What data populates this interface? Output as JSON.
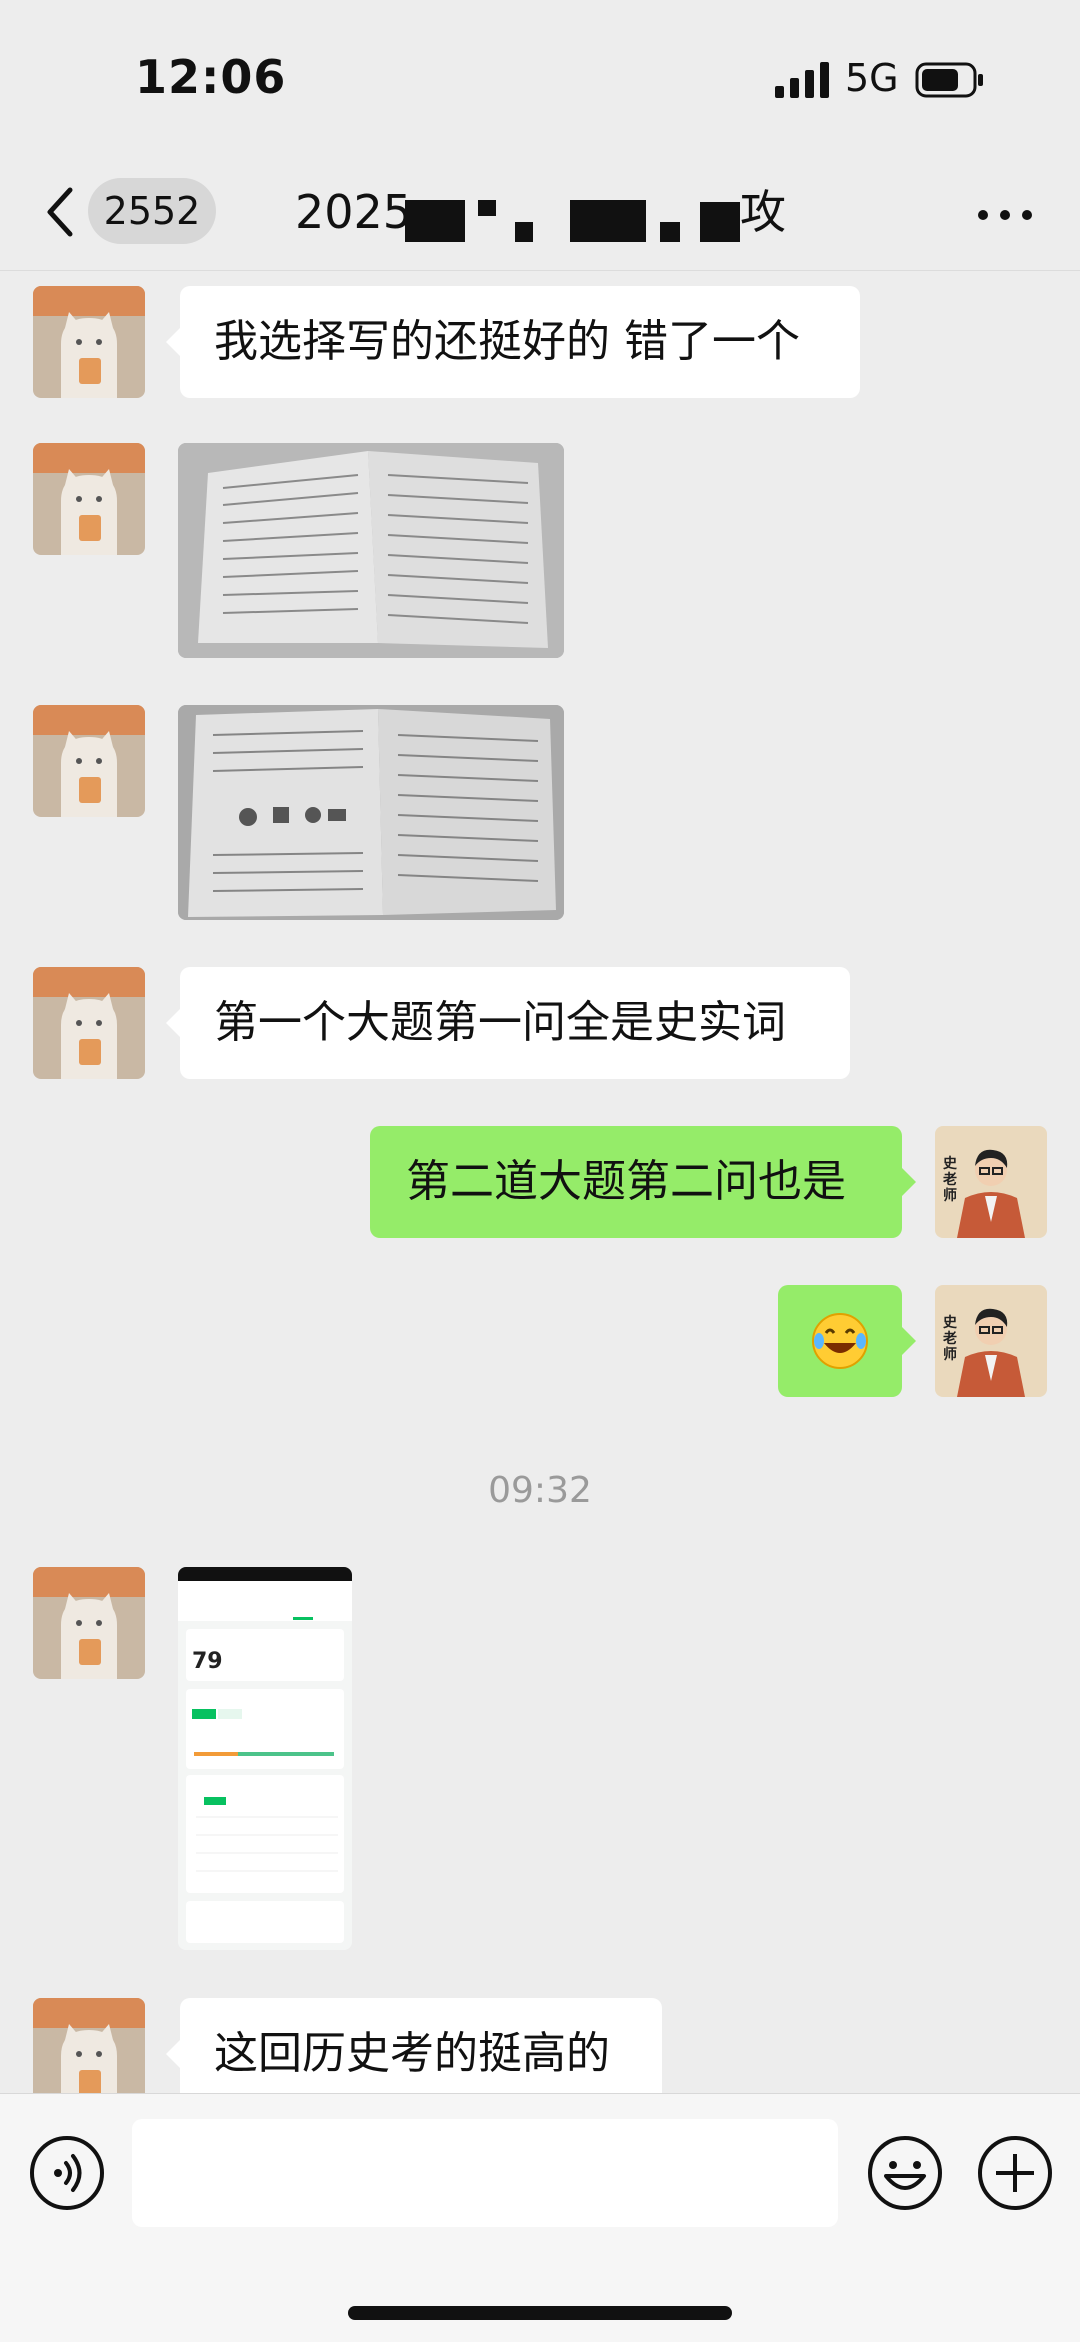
{
  "status_bar": {
    "time": "12:06",
    "network": "5G"
  },
  "header": {
    "back_badge_count": "2552",
    "title_prefix": "2025",
    "title_suffix": "攻"
  },
  "messages": [
    {
      "sender": "other",
      "type": "text",
      "text": "我选择写的还挺好的 错了一个"
    },
    {
      "sender": "other",
      "type": "image",
      "description": "exam-paper-photo"
    },
    {
      "sender": "other",
      "type": "image",
      "description": "exam-paper-photo"
    },
    {
      "sender": "other",
      "type": "text",
      "text": "第一个大题第一问全是史实词"
    },
    {
      "sender": "me",
      "type": "text",
      "text": "第二道大题第二问也是"
    },
    {
      "sender": "me",
      "type": "emoji",
      "text": "😂"
    },
    {
      "type": "timestamp",
      "text": "09:32"
    },
    {
      "sender": "other",
      "type": "image",
      "description": "score-report-screenshot",
      "score": "79"
    },
    {
      "sender": "other",
      "type": "text",
      "text": "这回历史考的挺高的"
    }
  ],
  "my_avatar_text": "史老师",
  "colors": {
    "background": "#ededed",
    "outgoing_bubble": "#95ec69",
    "incoming_bubble": "#ffffff",
    "accent_green": "#07c160"
  },
  "icons": [
    "back-icon",
    "more-icon",
    "voice-icon",
    "emoji-icon",
    "plus-icon"
  ]
}
